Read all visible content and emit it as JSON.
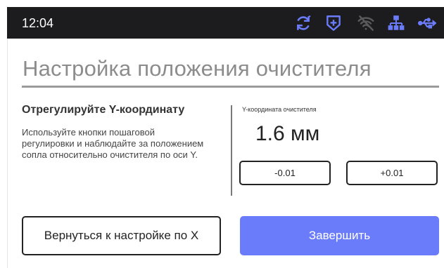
{
  "status_bar": {
    "time": "12:04",
    "icons": [
      "sync-icon",
      "shield-plus-icon",
      "wifi-off-icon",
      "network-icon",
      "usb-icon"
    ],
    "icon_color": "#6b7cfa",
    "muted_icon_color": "#5a5a5a"
  },
  "page": {
    "title": "Настройка положения очистителя",
    "heading": "Отрегулируйте Y-координату",
    "description": "Используйте кнопки пошаговой регулировки и наблюдайте за положением сопла относительно очистителя по оси Y."
  },
  "adjust": {
    "label": "Y-координата очистителя",
    "value": "1.6 мм",
    "decrement_label": "-0.01",
    "increment_label": "+0.01"
  },
  "footer": {
    "back_label": "Вернуться к настройке по X",
    "finish_label": "Завершить",
    "accent": "#6b7cfa"
  }
}
